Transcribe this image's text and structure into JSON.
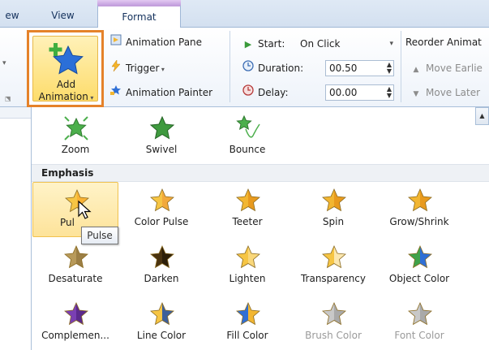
{
  "tabs": [
    {
      "label": "ew"
    },
    {
      "label": "View"
    },
    {
      "label": "Format"
    }
  ],
  "ribbon": {
    "add_animation": {
      "line1": "Add",
      "line2": "Animation"
    },
    "animation_pane": "Animation Pane",
    "trigger": "Trigger",
    "animation_painter": "Animation Painter",
    "start_label": "Start:",
    "start_value": "On Click",
    "duration_label": "Duration:",
    "duration_value": "00.50",
    "delay_label": "Delay:",
    "delay_value": "00.00",
    "reorder_title": "Reorder Animat",
    "move_earlier": "Move Earlie",
    "move_later": "Move Later"
  },
  "gallery": {
    "entrance_row": [
      {
        "label": "Zoom"
      },
      {
        "label": "Swivel"
      },
      {
        "label": "Bounce"
      }
    ],
    "emphasis_header": "Emphasis",
    "emphasis": [
      {
        "label": "Pulse",
        "display": "Pul",
        "selected": true
      },
      {
        "label": "Color Pulse"
      },
      {
        "label": "Teeter"
      },
      {
        "label": "Spin"
      },
      {
        "label": "Grow/Shrink"
      },
      {
        "label": "Desaturate"
      },
      {
        "label": "Darken"
      },
      {
        "label": "Lighten"
      },
      {
        "label": "Transparency"
      },
      {
        "label": "Object Color"
      },
      {
        "label": "Complemen..."
      },
      {
        "label": "Line Color"
      },
      {
        "label": "Fill Color"
      },
      {
        "label": "Brush Color",
        "disabled": true
      },
      {
        "label": "Font Color",
        "disabled": true
      }
    ]
  },
  "tooltip": "Pulse",
  "colors": {
    "highlight_border": "#e5822a",
    "selected_fill": "#fde39a",
    "star_gold": "#f2b632",
    "star_green": "#3f9a3f",
    "star_blue": "#2f6fd6"
  }
}
